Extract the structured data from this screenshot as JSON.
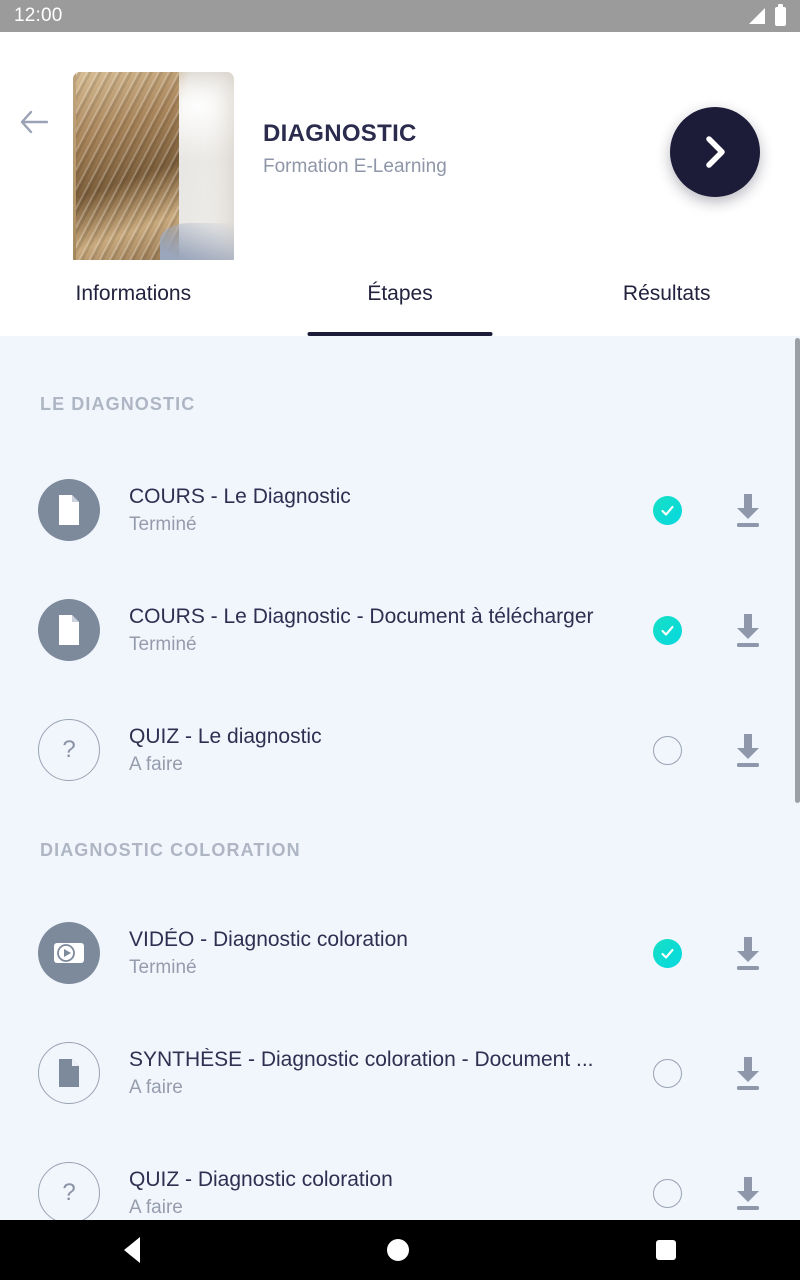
{
  "statusbar": {
    "time": "12:00",
    "signal_icon": "signal-icon",
    "battery_icon": "battery-icon"
  },
  "header": {
    "back_icon": "arrow-left-icon",
    "thumbnail_alt": "braided-hair-photo",
    "title": "DIAGNOSTIC",
    "subtitle": "Formation E-Learning",
    "next_icon": "chevron-right-icon",
    "next_button_color": "#1c1b38"
  },
  "tabs": [
    {
      "label": "Informations",
      "active": false
    },
    {
      "label": "Étapes",
      "active": true
    },
    {
      "label": "Résultats",
      "active": false
    }
  ],
  "colors": {
    "background": "#f1f5fc",
    "title_text": "#2d3050",
    "muted_text": "#959dad",
    "section_text": "#aeb6c4",
    "icon_circle": "#7d8a9c",
    "done_badge": "#10dccb",
    "accent_dark": "#1c1b38"
  },
  "sections": [
    {
      "title": "LE DIAGNOSTIC",
      "items": [
        {
          "icon": "document-icon",
          "icon_style": "filled",
          "title": "COURS - Le Diagnostic",
          "status": "Terminé",
          "state": "done",
          "download_icon": "download-icon"
        },
        {
          "icon": "document-icon",
          "icon_style": "filled",
          "title": "COURS - Le Diagnostic - Document à télécharger",
          "status": "Terminé",
          "state": "done",
          "download_icon": "download-icon"
        },
        {
          "icon": "question-icon",
          "icon_style": "outline",
          "title": "QUIZ - Le diagnostic",
          "status": "A faire",
          "state": "todo",
          "download_icon": "download-icon"
        }
      ]
    },
    {
      "title": "DIAGNOSTIC COLORATION",
      "items": [
        {
          "icon": "video-icon",
          "icon_style": "filled",
          "title": "VIDÉO - Diagnostic coloration",
          "status": "Terminé",
          "state": "done",
          "download_icon": "download-icon"
        },
        {
          "icon": "document-icon",
          "icon_style": "outline",
          "title": "SYNTHÈSE - Diagnostic coloration - Document ...",
          "status": "A faire",
          "state": "todo",
          "download_icon": "download-icon"
        },
        {
          "icon": "question-icon",
          "icon_style": "outline",
          "title": "QUIZ - Diagnostic coloration",
          "status": "A faire",
          "state": "todo",
          "download_icon": "download-icon"
        }
      ]
    }
  ],
  "navbar": {
    "back_icon": "android-back-icon",
    "home_icon": "android-home-icon",
    "recents_icon": "android-recents-icon"
  }
}
